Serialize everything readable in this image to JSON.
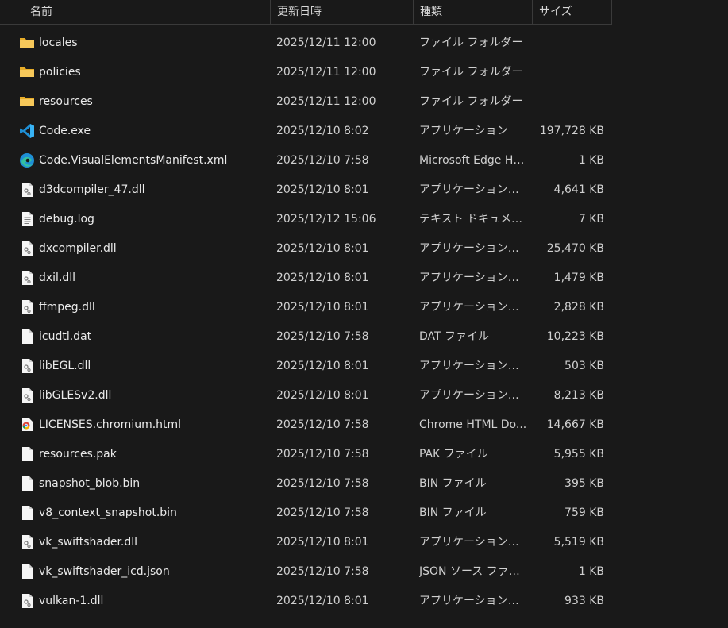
{
  "columns": {
    "name": "名前",
    "date": "更新日時",
    "type": "種類",
    "size": "サイズ"
  },
  "colors": {
    "background": "#191919",
    "folder": "#f4c24d",
    "vscode": "#23a9f2",
    "edge": "#1fa5d8",
    "chrome_red": "#db4437",
    "chrome_yellow": "#f4b400",
    "chrome_green": "#0f9d58",
    "chrome_blue": "#4285f4"
  },
  "files": [
    {
      "name": "locales",
      "date": "2025/12/11 12:00",
      "type": "ファイル フォルダー",
      "size": "",
      "icon": "folder"
    },
    {
      "name": "policies",
      "date": "2025/12/11 12:00",
      "type": "ファイル フォルダー",
      "size": "",
      "icon": "folder"
    },
    {
      "name": "resources",
      "date": "2025/12/11 12:00",
      "type": "ファイル フォルダー",
      "size": "",
      "icon": "folder"
    },
    {
      "name": "Code.exe",
      "date": "2025/12/10 8:02",
      "type": "アプリケーション",
      "size": "197,728 KB",
      "icon": "vscode"
    },
    {
      "name": "Code.VisualElementsManifest.xml",
      "date": "2025/12/10 7:58",
      "type": "Microsoft Edge HT...",
      "size": "1 KB",
      "icon": "edge"
    },
    {
      "name": "d3dcompiler_47.dll",
      "date": "2025/12/10 8:01",
      "type": "アプリケーション拡張",
      "size": "4,641 KB",
      "icon": "dll"
    },
    {
      "name": "debug.log",
      "date": "2025/12/12 15:06",
      "type": "テキスト ドキュメント",
      "size": "7 KB",
      "icon": "text"
    },
    {
      "name": "dxcompiler.dll",
      "date": "2025/12/10 8:01",
      "type": "アプリケーション拡張",
      "size": "25,470 KB",
      "icon": "dll"
    },
    {
      "name": "dxil.dll",
      "date": "2025/12/10 8:01",
      "type": "アプリケーション拡張",
      "size": "1,479 KB",
      "icon": "dll"
    },
    {
      "name": "ffmpeg.dll",
      "date": "2025/12/10 8:01",
      "type": "アプリケーション拡張",
      "size": "2,828 KB",
      "icon": "dll"
    },
    {
      "name": "icudtl.dat",
      "date": "2025/12/10 7:58",
      "type": "DAT ファイル",
      "size": "10,223 KB",
      "icon": "blank"
    },
    {
      "name": "libEGL.dll",
      "date": "2025/12/10 8:01",
      "type": "アプリケーション拡張",
      "size": "503 KB",
      "icon": "dll"
    },
    {
      "name": "libGLESv2.dll",
      "date": "2025/12/10 8:01",
      "type": "アプリケーション拡張",
      "size": "8,213 KB",
      "icon": "dll"
    },
    {
      "name": "LICENSES.chromium.html",
      "date": "2025/12/10 7:58",
      "type": "Chrome HTML Do...",
      "size": "14,667 KB",
      "icon": "chrome"
    },
    {
      "name": "resources.pak",
      "date": "2025/12/10 7:58",
      "type": "PAK ファイル",
      "size": "5,955 KB",
      "icon": "blank"
    },
    {
      "name": "snapshot_blob.bin",
      "date": "2025/12/10 7:58",
      "type": "BIN ファイル",
      "size": "395 KB",
      "icon": "blank"
    },
    {
      "name": "v8_context_snapshot.bin",
      "date": "2025/12/10 7:58",
      "type": "BIN ファイル",
      "size": "759 KB",
      "icon": "blank"
    },
    {
      "name": "vk_swiftshader.dll",
      "date": "2025/12/10 8:01",
      "type": "アプリケーション拡張",
      "size": "5,519 KB",
      "icon": "dll"
    },
    {
      "name": "vk_swiftshader_icd.json",
      "date": "2025/12/10 7:58",
      "type": "JSON ソース ファイル",
      "size": "1 KB",
      "icon": "blank"
    },
    {
      "name": "vulkan-1.dll",
      "date": "2025/12/10 8:01",
      "type": "アプリケーション拡張",
      "size": "933 KB",
      "icon": "dll"
    }
  ]
}
